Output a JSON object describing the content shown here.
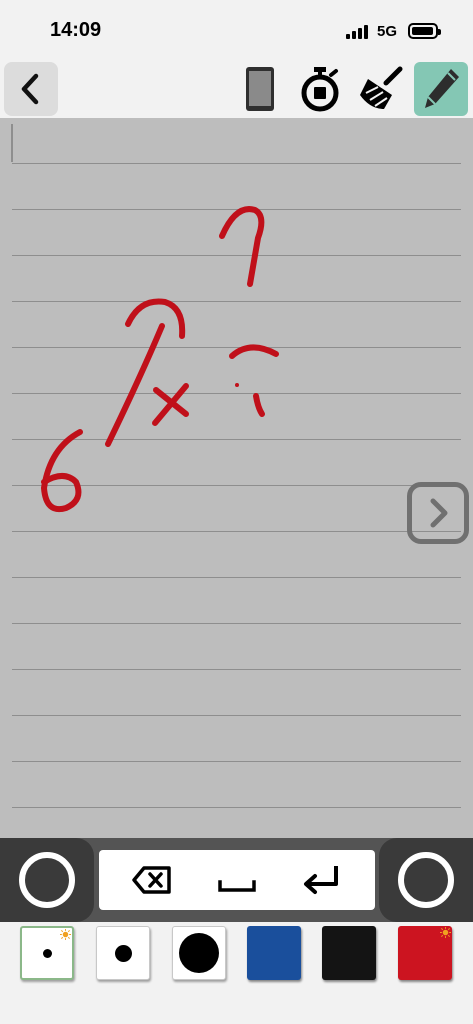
{
  "status_bar": {
    "time": "14:09",
    "network": "5G"
  },
  "toolbar": {
    "back_icon": "chevron-left-icon",
    "tools": [
      "phone-icon",
      "stopwatch-icon",
      "broom-icon",
      "pencil-icon"
    ],
    "active_tool": "pencil-icon"
  },
  "canvas": {
    "background": "#bdbdbd",
    "ink_color": "#c0101a",
    "next_icon": "chevron-right-icon"
  },
  "keyboard": {
    "keys": [
      "backspace-icon",
      "space-icon",
      "return-icon"
    ]
  },
  "palette": {
    "pens": [
      "small-dot",
      "medium-dot",
      "large-dot"
    ],
    "colors": [
      "#1a4f9c",
      "#141414",
      "#cc1420"
    ],
    "selected_pen": "small-dot",
    "selected_color": "#cc1420"
  }
}
